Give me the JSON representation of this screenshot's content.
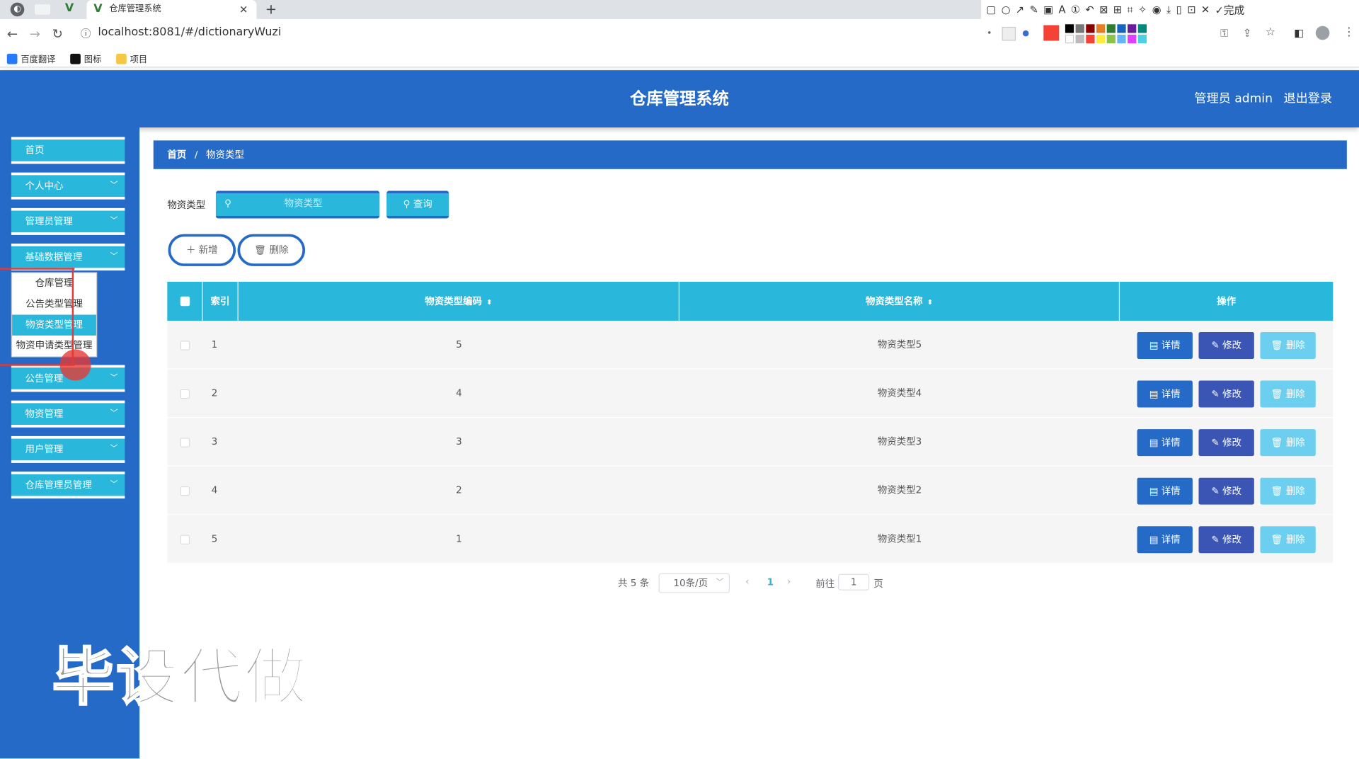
{
  "browser": {
    "tab_title": "仓库管理系统",
    "url": "localhost:8081/#/dictionaryWuzi",
    "bookmarks": [
      "百度翻译",
      "图标",
      "项目"
    ],
    "ext_done_label": "完成"
  },
  "header": {
    "title": "仓库管理系统",
    "user": "管理员 admin",
    "logout": "退出登录"
  },
  "sidebar": {
    "items": [
      {
        "label": "首页"
      },
      {
        "label": "个人中心"
      },
      {
        "label": "管理员管理"
      },
      {
        "label": "基础数据管理"
      },
      {
        "label": "公告管理"
      },
      {
        "label": "物资管理"
      },
      {
        "label": "用户管理"
      },
      {
        "label": "仓库管理员管理"
      }
    ],
    "submenu": [
      "仓库管理",
      "公告类型管理",
      "物资类型管理",
      "物资申请类型管理"
    ]
  },
  "breadcrumb": {
    "home": "首页",
    "sep": "/",
    "current": "物资类型"
  },
  "search": {
    "label": "物资类型",
    "placeholder": "物资类型",
    "button": "查询"
  },
  "actions": {
    "add": "新增",
    "delete": "删除"
  },
  "table": {
    "columns": [
      "索引",
      "物资类型编码",
      "物资类型名称",
      "操作"
    ],
    "rows": [
      {
        "index": "1",
        "code": "5",
        "name": "物资类型5"
      },
      {
        "index": "2",
        "code": "4",
        "name": "物资类型4"
      },
      {
        "index": "3",
        "code": "3",
        "name": "物资类型3"
      },
      {
        "index": "4",
        "code": "2",
        "name": "物资类型2"
      },
      {
        "index": "5",
        "code": "1",
        "name": "物资类型1"
      }
    ],
    "row_actions": {
      "detail": "详情",
      "edit": "修改",
      "delete": "删除"
    }
  },
  "pagination": {
    "total": "共 5 条",
    "page_size": "10条/页",
    "current": "1",
    "goto": "前往",
    "goto_value": "1",
    "page_unit": "页"
  },
  "watermark": "毕设代做"
}
